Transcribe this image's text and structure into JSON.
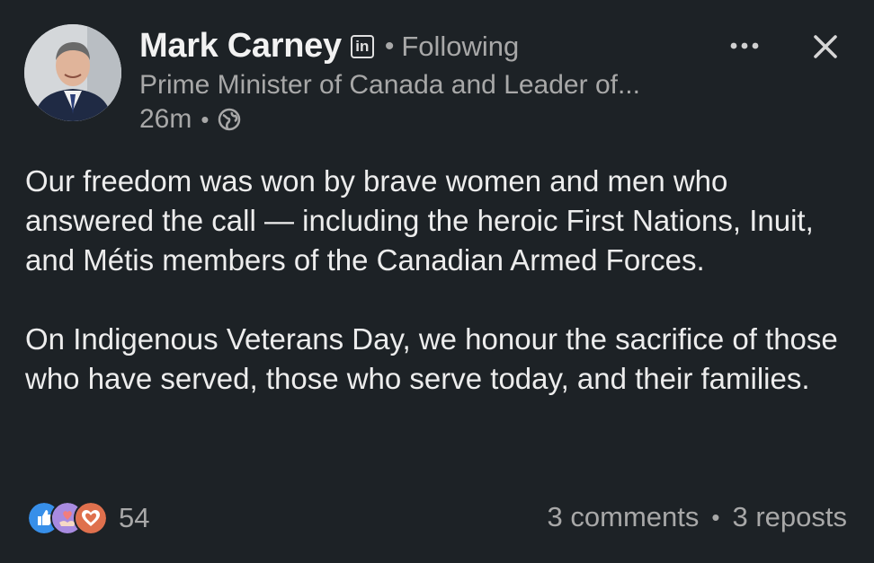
{
  "author": {
    "name": "Mark Carney",
    "badge": "in",
    "follow_status": "Following",
    "separator": "•",
    "headline": "Prime Minister of Canada and Leader of...",
    "posted_ago": "26m",
    "visibility_icon": "globe-icon"
  },
  "header_actions": {
    "more_icon": "more-options-icon",
    "close_icon": "close-icon"
  },
  "post": {
    "paragraphs": [
      "Our freedom was won by brave women and men who answered the call — including the heroic First Nations, Inuit, and Métis members of the Canadian Armed Forces.",
      "On Indigenous Veterans Day, we honour the sacrifice of those who have served, those who serve today, and their families."
    ]
  },
  "engagement": {
    "reaction_icons": [
      "like-icon",
      "support-icon",
      "love-icon"
    ],
    "reaction_count": "54",
    "comments": "3 comments",
    "separator": "•",
    "reposts": "3 reposts"
  },
  "colors": {
    "background": "#1d2226",
    "text_primary": "#ededed",
    "text_secondary": "#a8a8a8",
    "like_blue": "#378fe9",
    "support_purple": "#a88be0",
    "love_orange": "#df704d"
  }
}
